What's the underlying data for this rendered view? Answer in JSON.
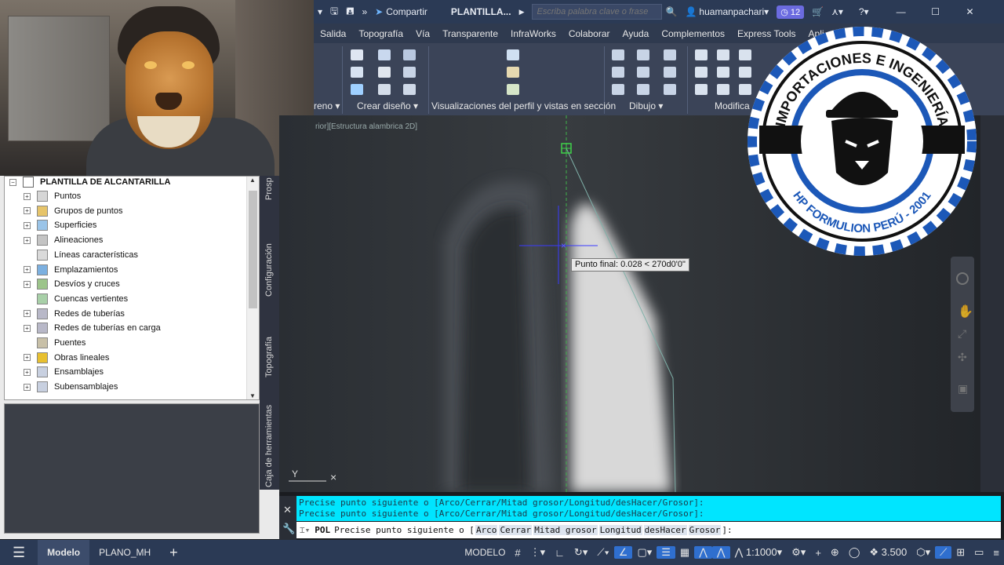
{
  "titlebar": {
    "share_label": "Compartir",
    "doc_title": "PLANTILLA...",
    "search_placeholder": "Escriba palabra clave o frase",
    "user": "huamanpachari",
    "notif_count": "12"
  },
  "ribbon_tabs": [
    "Salida",
    "Topografía",
    "Vía",
    "Transparente",
    "InfraWorks",
    "Colaborar",
    "Ayuda",
    "Complementos",
    "Express Tools",
    "Apli"
  ],
  "ribbon_groups": {
    "partial_group": "reno",
    "create_design": "Crear diseño",
    "profile_views": "Visualizaciones del perfil y vistas en sección",
    "draw": "Dibujo",
    "modify": "Modifica"
  },
  "toolspace": {
    "root": "PLANTILLA DE ALCANTARILLA",
    "items": [
      {
        "label": "Puntos",
        "expandable": true
      },
      {
        "label": "Grupos de puntos",
        "expandable": true
      },
      {
        "label": "Superficies",
        "expandable": true
      },
      {
        "label": "Alineaciones",
        "expandable": true
      },
      {
        "label": "Líneas características",
        "expandable": false
      },
      {
        "label": "Emplazamientos",
        "expandable": true
      },
      {
        "label": "Desvíos y cruces",
        "expandable": true
      },
      {
        "label": "Cuencas vertientes",
        "expandable": false
      },
      {
        "label": "Redes de tuberías",
        "expandable": true
      },
      {
        "label": "Redes de tuberías en carga",
        "expandable": true
      },
      {
        "label": "Puentes",
        "expandable": false
      },
      {
        "label": "Obras lineales",
        "expandable": true
      },
      {
        "label": "Ensamblajes",
        "expandable": true
      },
      {
        "label": "Subensamblajes",
        "expandable": true
      }
    ],
    "vertical_tabs": [
      "Prosp",
      "Configuración",
      "Topografía",
      "Caja de herramientas"
    ]
  },
  "canvas": {
    "view_label": "rior][Estructura alambrica 2D]",
    "tooltip": "Punto final: 0.028 < 270d0'0\"",
    "ucs_y": "Y"
  },
  "logo": {
    "top_text": "IMPORTACIONES E INGENIERÍA",
    "bottom_text": "HP FORMULION PERÚ - 2001"
  },
  "command": {
    "history": [
      "Precise punto siguiente o [Arco/Cerrar/Mitad grosor/Longitud/desHacer/Grosor]:",
      "Precise punto siguiente o [Arco/Cerrar/Mitad grosor/Longitud/desHacer/Grosor]:"
    ],
    "command_name": "POL",
    "prompt_start": "Precise punto siguiente o [",
    "options": [
      "Arco",
      "Cerrar",
      "Mitad grosor",
      "Longitud",
      "desHacer",
      "Grosor"
    ],
    "prompt_end": "]:"
  },
  "status": {
    "tab_model": "Modelo",
    "tab_layout": "PLANO_MH",
    "add_tab": "+",
    "space": "MODELO",
    "scale": "1:1000",
    "precision": "3.500"
  }
}
